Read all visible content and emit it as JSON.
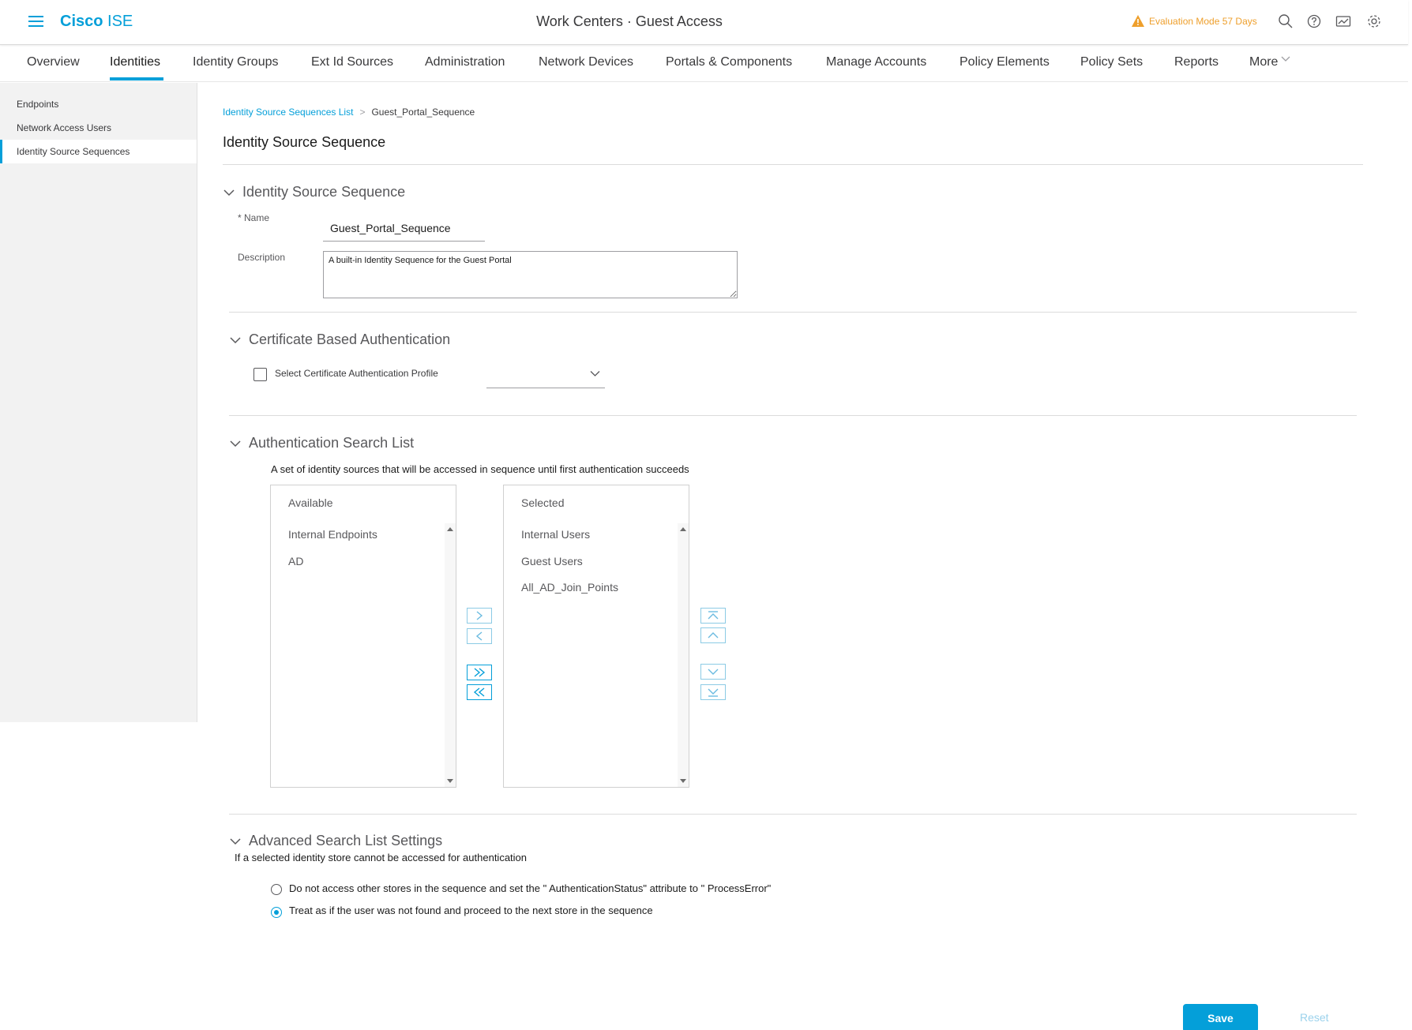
{
  "header": {
    "brand_bold": "Cisco",
    "brand_light": " ISE",
    "title": "Work Centers · Guest Access",
    "evaluation": "Evaluation Mode 57 Days",
    "icons": [
      "search-icon",
      "help-icon",
      "notifications-icon",
      "settings-icon"
    ],
    "accent_color": "#049fd9",
    "warning_color": "#ee9f2c"
  },
  "nav": {
    "tabs": [
      {
        "label": "Overview"
      },
      {
        "label": "Identities"
      },
      {
        "label": "Identity Groups"
      },
      {
        "label": "Ext Id Sources"
      },
      {
        "label": "Administration"
      },
      {
        "label": "Network Devices"
      },
      {
        "label": "Portals & Components"
      },
      {
        "label": "Manage Accounts"
      },
      {
        "label": "Policy Elements"
      },
      {
        "label": "Policy Sets"
      },
      {
        "label": "Reports"
      },
      {
        "label": "More"
      }
    ],
    "active": "Identities"
  },
  "sidebar": {
    "items": [
      {
        "label": "Endpoints"
      },
      {
        "label": "Network Access Users"
      },
      {
        "label": "Identity Source Sequences"
      }
    ],
    "active": "Identity Source Sequences"
  },
  "breadcrumb": {
    "link": "Identity Source Sequences List",
    "separator": ">",
    "current": "Guest_Portal_Sequence"
  },
  "page": {
    "title": "Identity Source Sequence"
  },
  "section_identity": {
    "title": "Identity Source Sequence",
    "name_label": "* Name",
    "name_value": "Guest_Portal_Sequence",
    "description_label": "Description",
    "description_value": "A built-in Identity Sequence for the Guest Portal"
  },
  "section_cert": {
    "title": "Certificate Based Authentication",
    "checkbox_label": "Select Certificate Authentication Profile",
    "checkbox_checked": false,
    "select_value": ""
  },
  "section_search": {
    "title": "Authentication Search List",
    "description": "A set of identity sources that will be accessed in sequence until first authentication succeeds",
    "available_title": "Available",
    "available_items": [
      "Internal Endpoints",
      "AD"
    ],
    "selected_title": "Selected",
    "selected_items": [
      "Internal Users",
      "Guest Users",
      "All_AD_Join_Points"
    ]
  },
  "section_advanced": {
    "title": "Advanced Search List Settings",
    "subtitle": "If a selected identity store cannot be accessed for authentication",
    "options": [
      {
        "label": "Do not access other stores in the sequence and set the \" AuthenticationStatus\"  attribute to \" ProcessError\"",
        "checked": false
      },
      {
        "label": "Treat as if the user was not found and proceed to the next store in the sequence",
        "checked": true
      }
    ]
  },
  "actions": {
    "save_label": "Save",
    "reset_label": "Reset"
  }
}
